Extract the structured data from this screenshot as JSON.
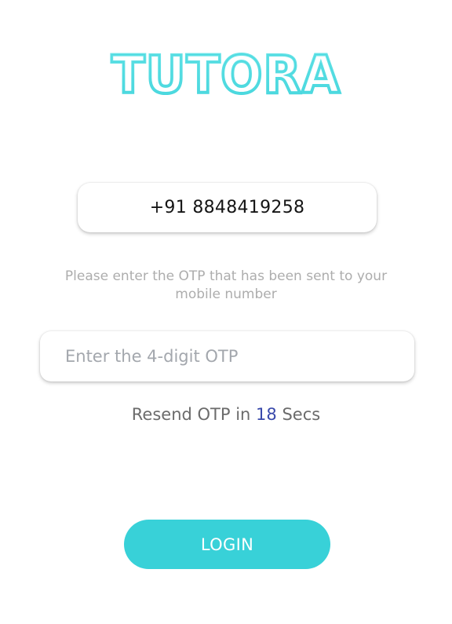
{
  "app": {
    "logo_text": "TUTORA",
    "brand_color": "#4fdbe0"
  },
  "phone": {
    "number": "+91 8848419258"
  },
  "instruction": {
    "text": "Please enter the OTP that has been sent to your mobile number"
  },
  "otp": {
    "placeholder": "Enter the 4-digit OTP",
    "value": ""
  },
  "resend": {
    "prefix": "Resend OTP in",
    "count": "18",
    "suffix": "Secs",
    "count_color": "#3949ab"
  },
  "login": {
    "label": "LOGIN",
    "color": "#38d1d8"
  }
}
